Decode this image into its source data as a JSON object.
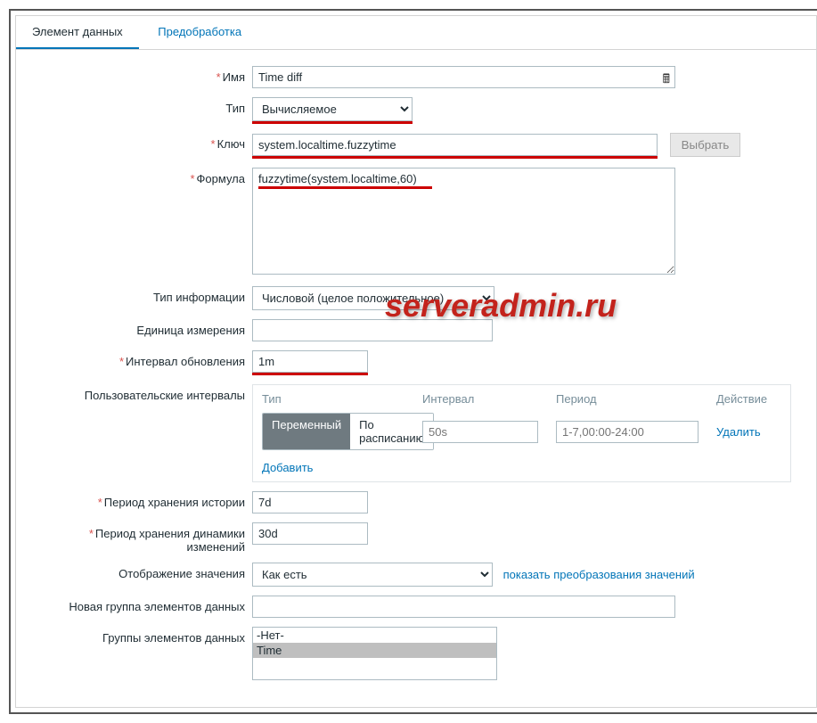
{
  "tabs": {
    "item": "Элемент данных",
    "preproc": "Предобработка"
  },
  "labels": {
    "name": "Имя",
    "type": "Тип",
    "key": "Ключ",
    "formula": "Формула",
    "infotype": "Тип информации",
    "unit": "Единица измерения",
    "update": "Интервал обновления",
    "custom": "Пользовательские интервалы",
    "history": "Период хранения истории",
    "trends": "Период хранения динамики изменений",
    "showvalue": "Отображение значения",
    "newgroup": "Новая группа элементов данных",
    "groups": "Группы элементов данных"
  },
  "values": {
    "name": "Time diff",
    "type": "Вычисляемое",
    "key": "system.localtime.fuzzytime",
    "formula": "fuzzytime(system.localtime,60)",
    "infotype": "Числовой (целое положительное)",
    "unit": "",
    "update": "1m",
    "history": "7d",
    "trends": "30d",
    "showvalue": "Как есть",
    "newgroup": ""
  },
  "btns": {
    "select": "Выбрать",
    "showmap": "показать преобразования значений",
    "add": "Добавить",
    "delete": "Удалить"
  },
  "intervals": {
    "h_type": "Тип",
    "h_interval": "Интервал",
    "h_period": "Период",
    "h_action": "Действие",
    "seg_flex": "Переменный",
    "seg_sched": "По расписанию",
    "ph_interval": "50s",
    "ph_period": "1-7,00:00-24:00"
  },
  "groups": {
    "none": "-Нет-",
    "time": "Time"
  },
  "watermark": "serveradmin.ru"
}
